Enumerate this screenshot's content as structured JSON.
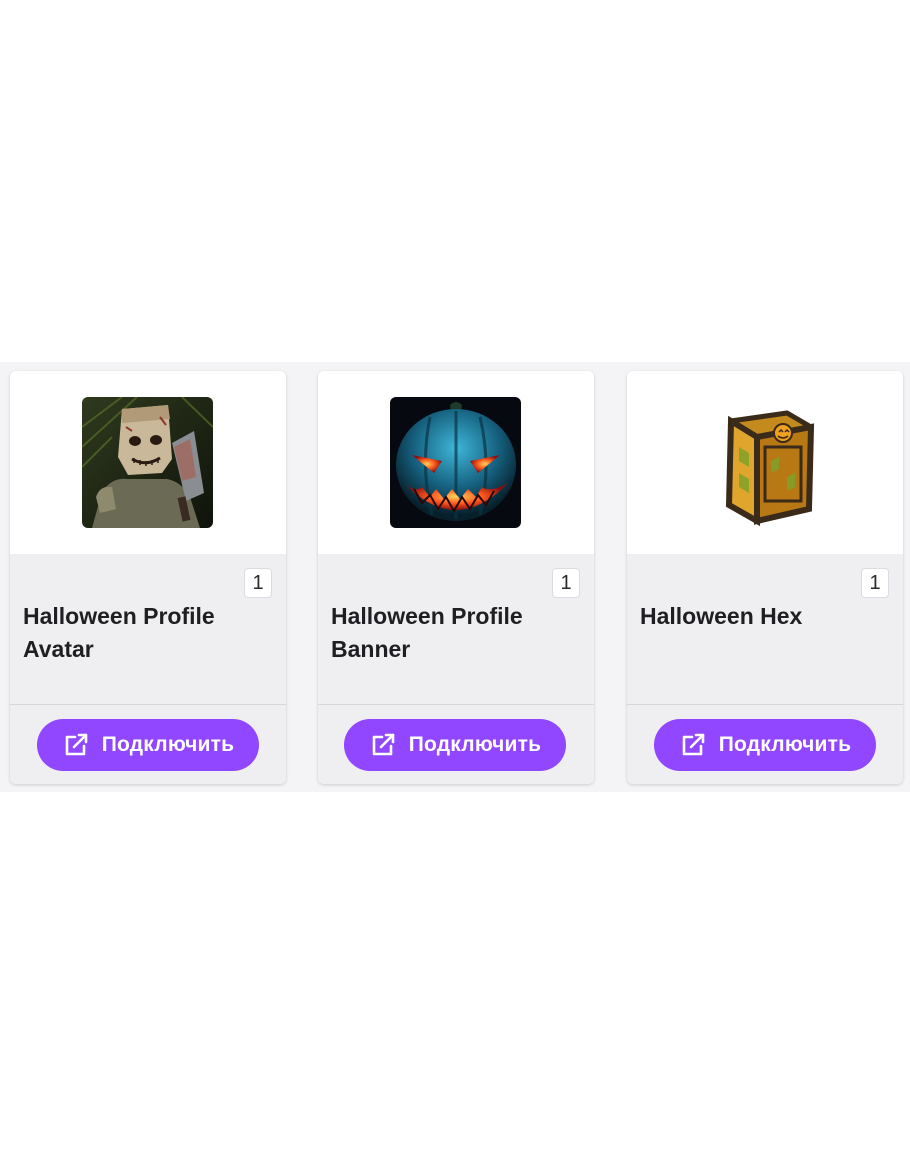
{
  "colors": {
    "accent": "#9147ff",
    "card_bg": "#efeff1",
    "page_strip": "#f4f4f6"
  },
  "cards": [
    {
      "thumbnail_icon": "scarecrow-avatar-icon",
      "count": "1",
      "title": "Halloween Profile Avatar",
      "button_label": "Подключить",
      "button_icon": "external-link-icon"
    },
    {
      "thumbnail_icon": "jack-o-lantern-banner-icon",
      "count": "1",
      "title": "Halloween Profile Banner",
      "button_label": "Подключить",
      "button_icon": "external-link-icon"
    },
    {
      "thumbnail_icon": "pumpkin-crate-icon",
      "count": "1",
      "title": "Halloween Hex",
      "button_label": "Подключить",
      "button_icon": "external-link-icon"
    }
  ]
}
